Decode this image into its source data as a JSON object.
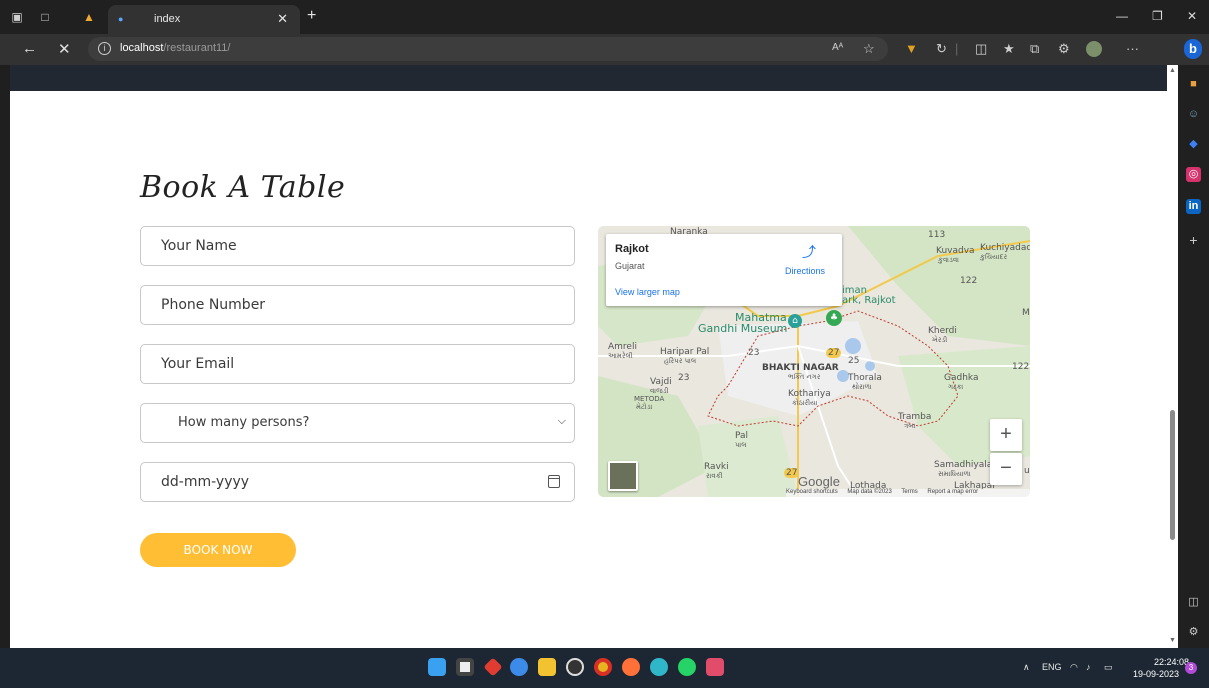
{
  "browser": {
    "tab_title": "index",
    "url_host": "localhost",
    "url_path": "/restaurant11/",
    "reader_label": "Aᴬ",
    "more_label": "···"
  },
  "form": {
    "heading": "Book A Table",
    "name_placeholder": "Your Name",
    "phone_placeholder": "Phone Number",
    "email_placeholder": "Your Email",
    "persons_placeholder": "How many persons?",
    "date_placeholder": "dd-mm-yyyy",
    "submit_label": "BOOK NOW"
  },
  "map": {
    "card_title": "Rajkot",
    "card_subtitle": "Gujarat",
    "directions_label": "Directions",
    "larger_map_label": "View larger map",
    "zoom_in": "+",
    "zoom_out": "−",
    "google_label": "Google",
    "footer": [
      "Keyboard shortcuts",
      "Map data ©2023",
      "Terms",
      "Report a map error"
    ],
    "labels": {
      "naranka": "Naranka",
      "kuvadva": "Kuvadva",
      "kuvadva_gu": "કુવાડવા",
      "kuchiyadad": "Kuchiyadad",
      "kuchiyadad_gu": "કુચિયાદર",
      "park": "iman\nark, Rajkot",
      "mahatma": "Mahatma",
      "gandhi": "Gandhi Museum",
      "amreli": "Amreli",
      "amreli_gu": "આમરેલી",
      "haripar": "Haripar Pal",
      "haripar_gu": "હરિપર પાલ",
      "bhakti": "BHAKTI NAGAR",
      "bhakti_gu": "ભક્તિ નગર",
      "thorala": "Thorala",
      "thorala_gu": "થોરાળા",
      "vajdi": "Vajdi",
      "vajdi_gu": "વાજડી",
      "metoda": "METODA",
      "metoda_gu": "મેટોડા",
      "kothariya": "Kothariya",
      "kothariya_gu": "કોઠારીયા",
      "kherdi": "Kherdi",
      "kherdi_gu": "ખેરડી",
      "gadhka": "Gadhka",
      "gadhka_gu": "ગઢકા",
      "tramba": "Tramba",
      "tramba_gu": "ત્રંબા",
      "pal": "Pal",
      "pal_gu": "પાલ",
      "ravki": "Ravki",
      "ravki_gu": "રાવકી",
      "samadhiyala": "Samadhiyala",
      "samadhiyala_gu": "સમાધિયાળા",
      "lothada": "Lothada",
      "lakhapar": "Lakhapar",
      "m": "M",
      "up": "u",
      "r113": "113",
      "r122a": "122",
      "r122b": "122",
      "r23a": "23",
      "r23b": "23",
      "r25": "25",
      "r27a": "27",
      "r27b": "27"
    }
  },
  "taskbar": {
    "lang": "ENG",
    "time": "22:24:08",
    "date": "19-09-2023",
    "notif_count": "3"
  },
  "colors": {
    "accent": "#ffbe33",
    "header": "#222831",
    "link": "#1a73e8"
  }
}
